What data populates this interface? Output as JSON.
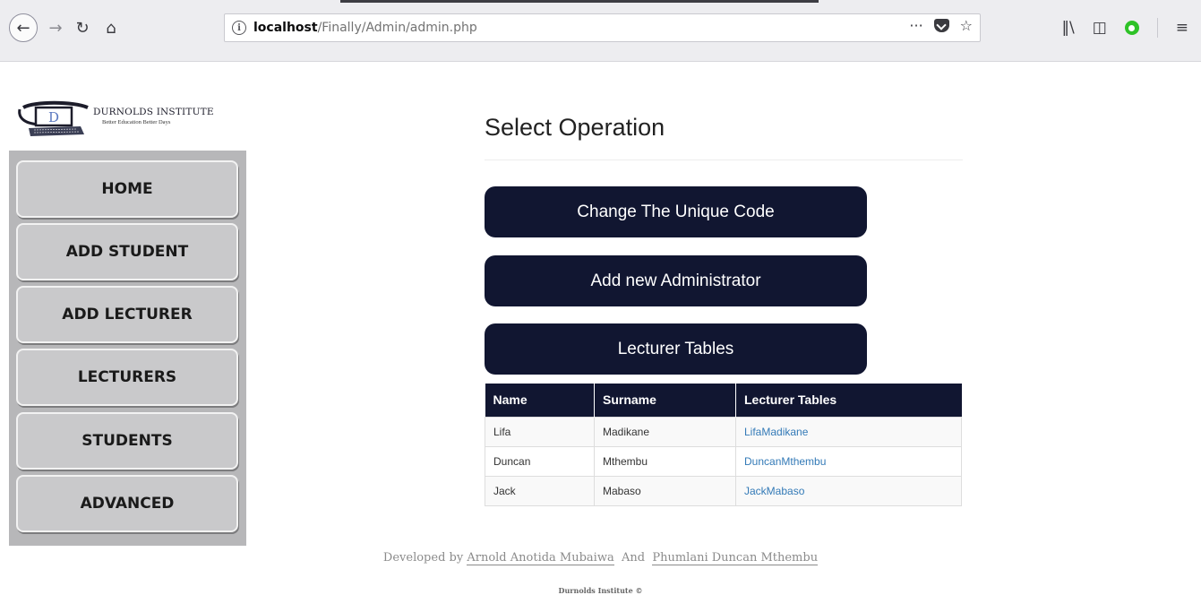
{
  "browser": {
    "url_host": "localhost",
    "url_path": "/Finally/Admin/admin.php",
    "page_actions": "···"
  },
  "logo": {
    "letter": "D",
    "title": "DURNOLDS INSTITUTE",
    "tagline": "Better Education Better Days"
  },
  "sidebar": {
    "items": [
      {
        "label": "HOME"
      },
      {
        "label": "ADD STUDENT"
      },
      {
        "label": "ADD LECTURER"
      },
      {
        "label": "LECTURERS"
      },
      {
        "label": "STUDENTS"
      },
      {
        "label": "ADVANCED"
      }
    ]
  },
  "main": {
    "heading": "Select Operation",
    "buttons": [
      {
        "label": "Change The Unique Code"
      },
      {
        "label": "Add new Administrator"
      },
      {
        "label": "Lecturer Tables"
      }
    ],
    "table": {
      "headers": [
        "Name",
        "Surname",
        "Lecturer Tables"
      ],
      "rows": [
        {
          "name": "Lifa",
          "surname": "Madikane",
          "link": "LifaMadikane"
        },
        {
          "name": "Duncan",
          "surname": "Mthembu",
          "link": "DuncanMthembu"
        },
        {
          "name": "Jack",
          "surname": "Mabaso",
          "link": "JackMabaso"
        }
      ]
    }
  },
  "footer": {
    "prefix": "Developed by",
    "dev1": "Arnold Anotida Mubaiwa",
    "joiner": "And",
    "dev2": "Phumlani Duncan Mthembu",
    "copyright": "Durnolds Institute ©"
  },
  "colors": {
    "navy": "#111631",
    "sidebar_bg": "#b7b7b9",
    "link": "#337ab7"
  }
}
